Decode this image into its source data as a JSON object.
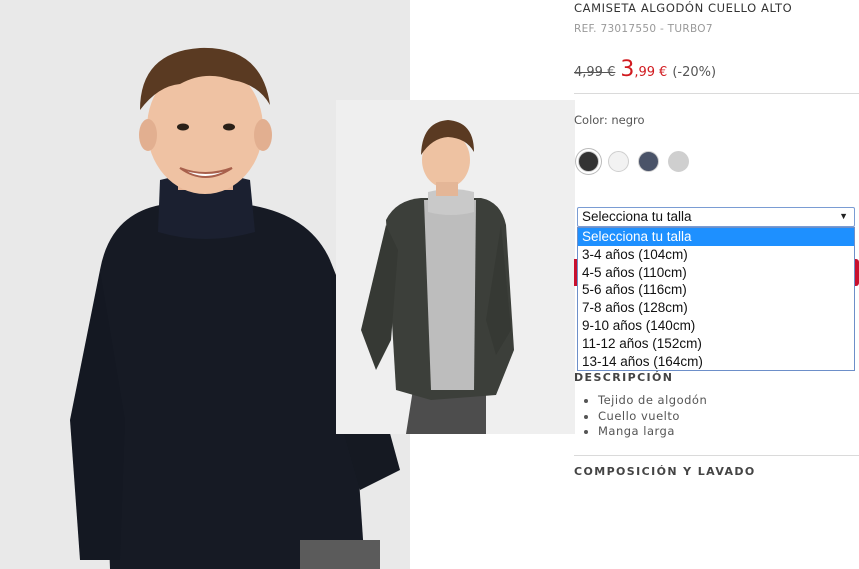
{
  "product": {
    "title": "CAMISETA ALGODÓN CUELLO ALTO",
    "ref": "REF. 73017550 - TURBO7",
    "price_old": "4,99 €",
    "price_new_int": "3",
    "price_new_dec": ",99",
    "price_new_currency": "€",
    "discount": "(-20%)"
  },
  "color": {
    "label": "Color: negro",
    "swatches": [
      {
        "name": "negro",
        "hex": "#333333",
        "selected": true
      },
      {
        "name": "blanco",
        "hex": "#f2f2f2",
        "selected": false
      },
      {
        "name": "marino",
        "hex": "#4a5368",
        "selected": false
      },
      {
        "name": "gris",
        "hex": "#cfcfcf",
        "selected": false
      }
    ]
  },
  "size_select": {
    "value": "Selecciona tu talla",
    "options": [
      "Selecciona tu talla",
      "3-4 años (104cm)",
      "4-5 años (110cm)",
      "5-6 años (116cm)",
      "7-8 años (128cm)",
      "9-10 años (140cm)",
      "11-12 años (152cm)",
      "13-14 años (164cm)"
    ],
    "highlighted_index": 0
  },
  "description": {
    "title": "DESCRIPCIÓN",
    "items": [
      "Tejido de algodón",
      "Cuello vuelto",
      "Manga larga"
    ]
  },
  "composition": {
    "title": "COMPOSICIÓN Y LAVADO"
  },
  "colors": {
    "sale_red": "#d11a1f",
    "highlight_blue": "#1e90ff"
  }
}
